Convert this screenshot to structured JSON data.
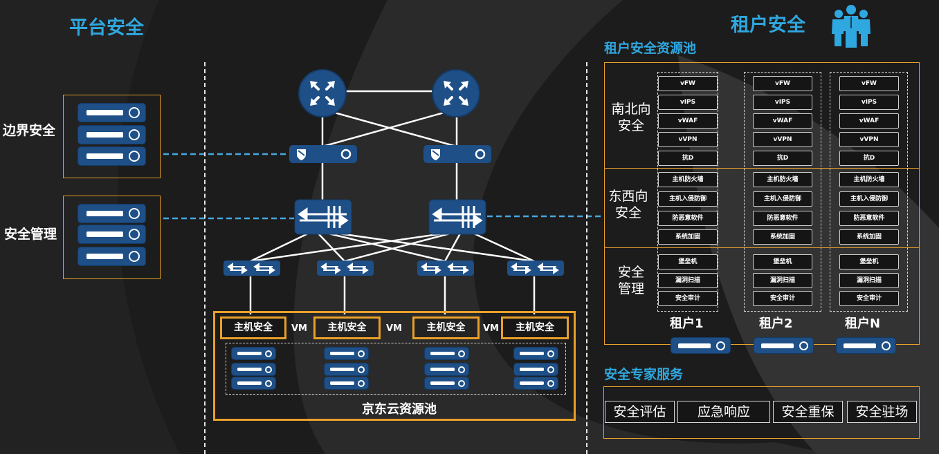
{
  "platform": {
    "title": "平台安全",
    "border_security": "边界安全",
    "security_mgmt": "安全管理"
  },
  "network": {
    "host_security_label": "主机安全",
    "vm_label": "VM",
    "pool_name": "京东云资源池"
  },
  "tenant": {
    "title": "租户安全",
    "pool_title": "租户安全资源池",
    "categories": [
      "南北向安全",
      "东西向安全",
      "安全管理"
    ],
    "category_lines": [
      [
        "南北向",
        "安全"
      ],
      [
        "东西向",
        "安全"
      ],
      [
        "安全",
        "管理"
      ]
    ],
    "columns": [
      {
        "name": "租户1"
      },
      {
        "name": "租户2"
      },
      {
        "name": "租户N"
      }
    ],
    "ns_items": [
      "vFW",
      "vIPS",
      "vWAF",
      "vVPN",
      "抗D"
    ],
    "ew_items": [
      "主机防火墙",
      "主机入侵防御",
      "防恶意软件",
      "系统加固"
    ],
    "mgmt_items": [
      "堡垒机",
      "漏洞扫描",
      "安全审计"
    ]
  },
  "expert": {
    "title": "安全专家服务",
    "services": [
      "安全评估",
      "应急响应",
      "安全重保",
      "安全驻场"
    ]
  },
  "colors": {
    "accent_blue": "#2fa8e0",
    "device_blue": "#1e4f86",
    "orange": "#e8a02a"
  },
  "icons": {
    "people": "people-group-icon",
    "router": "router-icon",
    "firewall": "firewall-icon",
    "core_switch": "core-switch-icon",
    "access_switch": "access-switch-icon",
    "server": "server-icon"
  }
}
